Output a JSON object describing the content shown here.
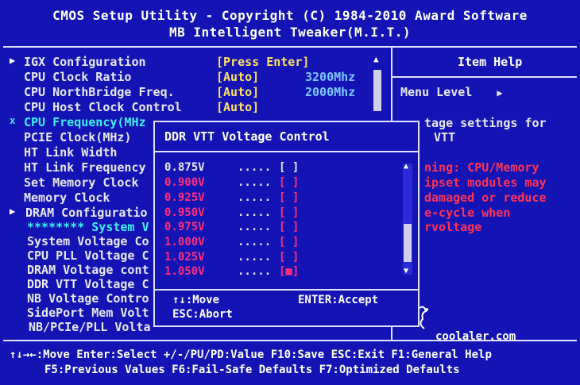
{
  "header": {
    "line1": "CMOS Setup Utility - Copyright (C) 1984-2010 Award Software",
    "line2": "MB Intelligent Tweaker(M.I.T.)"
  },
  "menu": {
    "items": [
      {
        "arrow": "▶",
        "label": "IGX Configuration",
        "value": "[Press Enter]",
        "mhz": ""
      },
      {
        "arrow": "",
        "label": "CPU Clock Ratio",
        "value": "[Auto]",
        "mhz": "3200Mhz"
      },
      {
        "arrow": "",
        "label": "CPU NorthBridge Freq.",
        "value": "[Auto]",
        "mhz": "2000Mhz"
      },
      {
        "arrow": "",
        "label": "CPU Host Clock Control",
        "value": "[Auto]",
        "mhz": ""
      },
      {
        "arrow": "x",
        "label": "CPU Frequency(MHz",
        "value": "",
        "mhz": ""
      },
      {
        "arrow": "",
        "label": "PCIE Clock(MHz)",
        "value": "",
        "mhz": ""
      },
      {
        "arrow": "",
        "label": "HT Link Width",
        "value": "",
        "mhz": ""
      },
      {
        "arrow": "",
        "label": "HT Link Frequency",
        "value": "",
        "mhz": ""
      },
      {
        "arrow": "",
        "label": "Set Memory Clock",
        "value": "",
        "mhz": ""
      },
      {
        "arrow": "",
        "label": "Memory Clock",
        "value": "",
        "mhz": ""
      },
      {
        "arrow": "▶",
        "label": "DRAM Configuratio",
        "value": "",
        "mhz": ""
      },
      {
        "arrow": "",
        "label": "******** System V",
        "value": "",
        "mhz": ""
      },
      {
        "arrow": "",
        "label": "System Voltage Co",
        "value": "",
        "mhz": ""
      },
      {
        "arrow": "",
        "label": "CPU PLL Voltage C",
        "value": "",
        "mhz": ""
      },
      {
        "arrow": "",
        "label": "DRAM Voltage cont",
        "value": "",
        "mhz": ""
      },
      {
        "arrow": "",
        "label": "DDR VTT Voltage C",
        "value": "",
        "mhz": ""
      },
      {
        "arrow": "",
        "label": "NB Voltage Contro",
        "value": "",
        "mhz": ""
      },
      {
        "arrow": "",
        "label": "SidePort Mem Volt",
        "value": "",
        "mhz": ""
      },
      {
        "arrow": "",
        "label": "NB/PCIe/PLL Volta",
        "value": "",
        "mhz": ""
      }
    ],
    "scroll_up": "▲"
  },
  "help": {
    "title": "Item Help",
    "menu_level": "Menu Level",
    "menu_level_arrow": "▶",
    "lines": [
      {
        "text": "tage settings for",
        "color": "#e8e8f0"
      },
      {
        "text": "VTT",
        "color": "#e8e8f0"
      },
      {
        "text": "ning: CPU/Memory",
        "color": "#ff3355"
      },
      {
        "text": "ipset modules may",
        "color": "#ff3355"
      },
      {
        "text": "damaged or reduce",
        "color": "#ff3355"
      },
      {
        "text": "e-cycle when",
        "color": "#ff3355"
      },
      {
        "text": "rvoltage",
        "color": "#ff3355"
      }
    ]
  },
  "popup": {
    "title": "DDR VTT Voltage Control",
    "options": [
      {
        "value": "0.875V",
        "dots": ".....",
        "box": "[ ]",
        "style": "white"
      },
      {
        "value": "0.900V",
        "dots": ".....",
        "box": "[ ]",
        "style": "red"
      },
      {
        "value": "0.925V",
        "dots": ".....",
        "box": "[ ]",
        "style": "red"
      },
      {
        "value": "0.950V",
        "dots": ".....",
        "box": "[ ]",
        "style": "red"
      },
      {
        "value": "0.975V",
        "dots": ".....",
        "box": "[ ]",
        "style": "red"
      },
      {
        "value": "1.000V",
        "dots": ".....",
        "box": "[ ]",
        "style": "red"
      },
      {
        "value": "1.025V",
        "dots": ".....",
        "box": "[ ]",
        "style": "red"
      },
      {
        "value": "1.050V",
        "dots": ".....",
        "box": "[■]",
        "style": "red"
      }
    ],
    "hint_move": "↑↓:Move",
    "hint_enter": "ENTER:Accept",
    "hint_esc": "ESC:Abort",
    "scroll_up": "▲",
    "scroll_down": "▼"
  },
  "footer": {
    "line1": "↑↓→←:Move  Enter:Select  +/-/PU/PD:Value  F10:Save  ESC:Exit  F1:General Help",
    "line2": "F5:Previous Values  F6:Fail-Safe Defaults  F7:Optimized Defaults"
  },
  "watermark": "coolaler.com",
  "colors": {
    "background": "#1414b4",
    "value_yellow": "#ffe066",
    "mhz_blue": "#7fc6ff",
    "warning_red": "#ff3355",
    "highlight_cyan": "#3ff0f0"
  }
}
